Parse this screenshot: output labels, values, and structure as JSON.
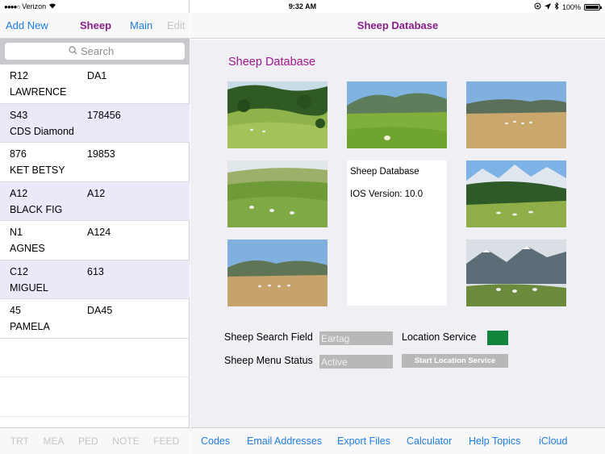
{
  "status_bar": {
    "carrier": "Verizon",
    "time": "9:32 AM",
    "battery": "100%",
    "battery_level": 1.0
  },
  "left_nav": {
    "add_new": "Add New",
    "title": "Sheep",
    "main": "Main",
    "edit": "Edit"
  },
  "search": {
    "placeholder": "Search"
  },
  "sheep_list": [
    {
      "tag": "R12",
      "number": "DA1",
      "name": "LAWRENCE"
    },
    {
      "tag": "S43",
      "number": "178456",
      "name": "CDS Diamond"
    },
    {
      "tag": "876",
      "number": "19853",
      "name": "KET BETSY"
    },
    {
      "tag": "A12",
      "number": "A12",
      "name": "BLACK FIG"
    },
    {
      "tag": "N1",
      "number": "A124",
      "name": "AGNES"
    },
    {
      "tag": "C12",
      "number": "613",
      "name": "MIGUEL"
    },
    {
      "tag": "45",
      "number": "DA45",
      "name": "PAMELA"
    }
  ],
  "left_tabs": [
    "TRT",
    "MEA",
    "PED",
    "NOTE",
    "FEED"
  ],
  "right_nav": {
    "title": "Sheep Database"
  },
  "content": {
    "title": "Sheep Database",
    "info_title": "Sheep Database",
    "ios_version": "IOS Version:  10.0",
    "search_field_label": "Sheep Search Field",
    "search_field_value": "Eartag",
    "menu_status_label": "Sheep Menu Status",
    "menu_status_value": "Active",
    "location_label": "Location Service",
    "location_button": "Start Location Service",
    "location_color": "#12843c"
  },
  "bottom_bar": [
    "Codes",
    "Email Addresses",
    "Export Files",
    "Calculator",
    "Help Topics",
    "iCloud"
  ]
}
